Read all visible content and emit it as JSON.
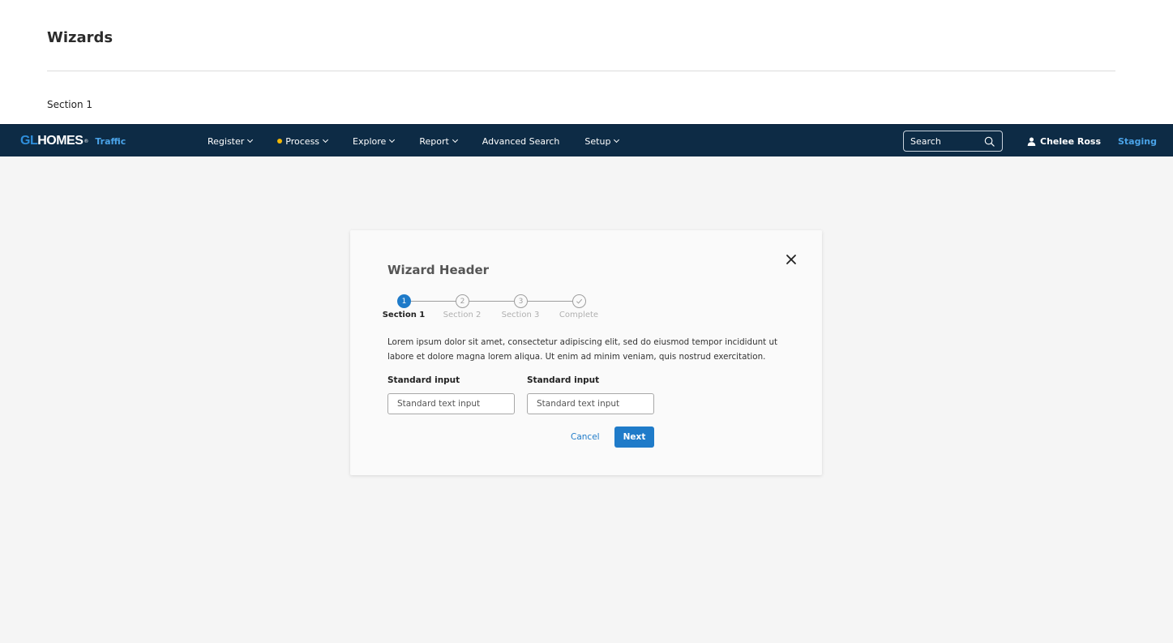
{
  "page": {
    "title": "Wizards",
    "section_label": "Section 1"
  },
  "navbar": {
    "brand_gl": "GL",
    "brand_homes": "HOMES",
    "brand_mark": "®",
    "app_name": "Traffic",
    "items": [
      {
        "label": "Register",
        "has_dropdown": true,
        "has_dot": false
      },
      {
        "label": "Process",
        "has_dropdown": true,
        "has_dot": true
      },
      {
        "label": "Explore",
        "has_dropdown": true,
        "has_dot": false
      },
      {
        "label": "Report",
        "has_dropdown": true,
        "has_dot": false
      },
      {
        "label": "Advanced Search",
        "has_dropdown": false,
        "has_dot": false
      },
      {
        "label": "Setup",
        "has_dropdown": true,
        "has_dot": false
      }
    ],
    "search_placeholder": "Search",
    "user_name": "Chelee Ross",
    "environment": "Staging",
    "colors": {
      "background": "#0d2b45",
      "accent": "#4aa3e8",
      "dot": "#f2b705"
    }
  },
  "wizard": {
    "header": "Wizard Header",
    "steps": [
      {
        "number": "1",
        "label": "Section 1",
        "state": "active"
      },
      {
        "number": "2",
        "label": "Section 2",
        "state": "inactive"
      },
      {
        "number": "3",
        "label": "Section 3",
        "state": "inactive"
      },
      {
        "number": "",
        "label": "Complete",
        "state": "inactive",
        "icon": "check-icon"
      }
    ],
    "description": "Lorem ipsum dolor sit amet, consectetur adipiscing elit, sed do eiusmod tempor incididunt ut labore et dolore magna lorem aliqua. Ut enim ad minim veniam, quis nostrud exercitation.",
    "fields": [
      {
        "label": "Standard input",
        "placeholder": "Standard text input",
        "value": ""
      },
      {
        "label": "Standard input",
        "placeholder": "Standard text input",
        "value": ""
      }
    ],
    "cancel_label": "Cancel",
    "next_label": "Next",
    "colors": {
      "primary": "#1f7bc9"
    }
  }
}
